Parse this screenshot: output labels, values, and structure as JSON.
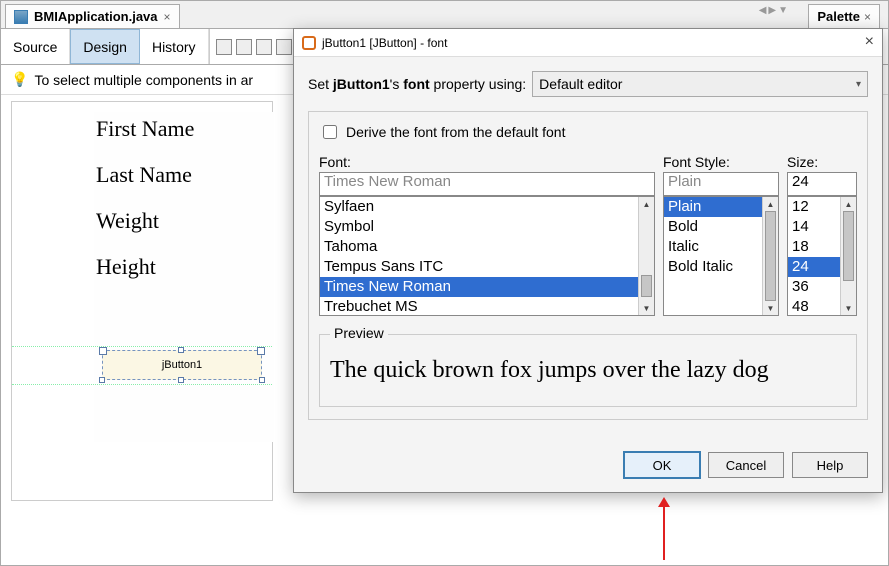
{
  "ide": {
    "tab_label": "BMIApplication.java",
    "palette_label": "Palette",
    "toolbar": {
      "source": "Source",
      "design": "Design",
      "history": "History"
    },
    "hint": "To select multiple components in ar"
  },
  "design": {
    "labels": [
      "First Name",
      "Last Name",
      "Weight",
      "Height"
    ],
    "button_text": "jButton1"
  },
  "dialog": {
    "title": "jButton1 [JButton] - font",
    "set_prefix": "Set ",
    "set_bold": "jButton1",
    "set_mid": "'s ",
    "set_bold2": "font",
    "set_suffix": " property using:",
    "editor_mode": "Default editor",
    "derive_label": "Derive the font from the default font",
    "font_label": "Font:",
    "style_label": "Font Style:",
    "size_label": "Size:",
    "font_value": "Times New Roman",
    "style_value": "Plain",
    "size_value": "24",
    "font_list": [
      "Sylfaen",
      "Symbol",
      "Tahoma",
      "Tempus Sans ITC",
      "Times New Roman",
      "Trebuchet MS"
    ],
    "font_selected": "Times New Roman",
    "style_list": [
      "Plain",
      "Bold",
      "Italic",
      "Bold Italic"
    ],
    "style_selected": "Plain",
    "size_list": [
      "12",
      "14",
      "18",
      "24",
      "36",
      "48"
    ],
    "size_selected": "24",
    "preview_legend": "Preview",
    "preview_text": "The quick brown fox jumps over the lazy dog",
    "buttons": {
      "ok": "OK",
      "cancel": "Cancel",
      "help": "Help"
    }
  }
}
